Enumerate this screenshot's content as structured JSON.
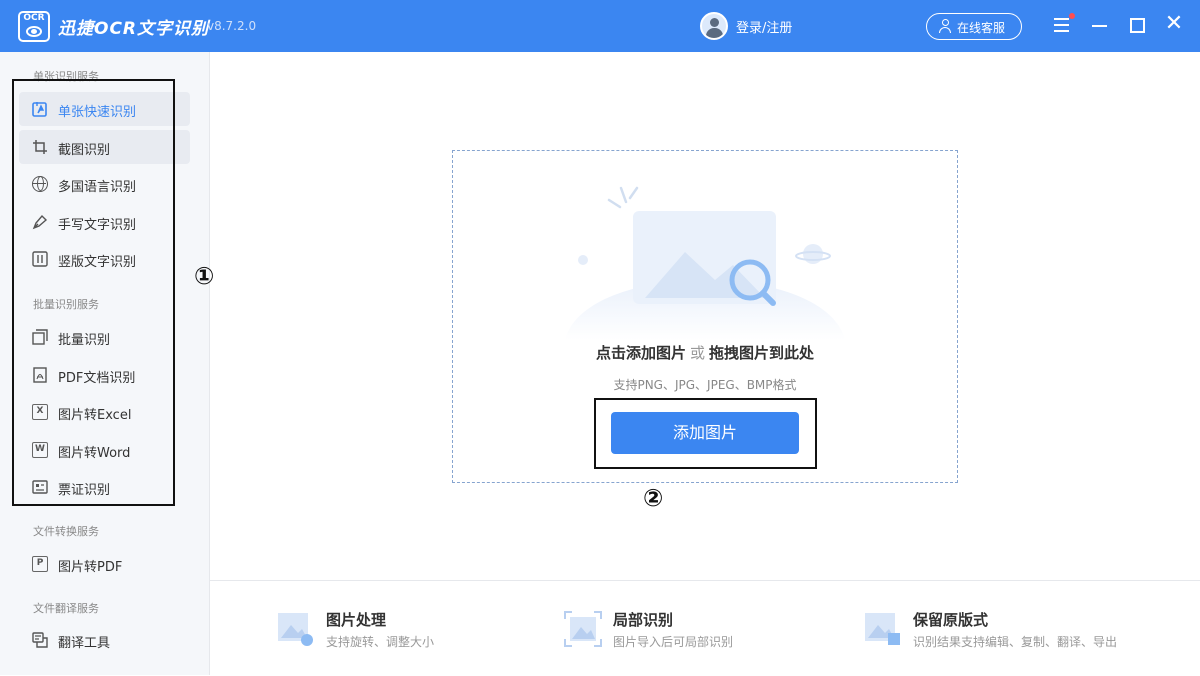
{
  "window": {
    "logo_text": "OCR",
    "title": "迅捷OCR文字识别",
    "version": "v8.7.2.0",
    "login_label": "登录/注册",
    "service_label": "在线客服",
    "close_glyph": "✕"
  },
  "sidebar": {
    "sections": [
      {
        "title": "单张识别服务",
        "items": [
          {
            "label": "单张快速识别",
            "icon": "quick-recognize-icon",
            "active": true
          },
          {
            "label": "截图识别",
            "icon": "crop-icon"
          },
          {
            "label": "多国语言识别",
            "icon": "globe-icon"
          },
          {
            "label": "手写文字识别",
            "icon": "pen-icon"
          },
          {
            "label": "竖版文字识别",
            "icon": "vertical-text-icon"
          }
        ]
      },
      {
        "title": "批量识别服务",
        "items": [
          {
            "label": "批量识别",
            "icon": "batch-icon"
          },
          {
            "label": "PDF文档识别",
            "icon": "pdf-icon"
          },
          {
            "label": "图片转Excel",
            "icon": "excel-icon",
            "icon_letter": "X"
          },
          {
            "label": "图片转Word",
            "icon": "word-icon",
            "icon_letter": "W"
          },
          {
            "label": "票证识别",
            "icon": "ticket-icon"
          }
        ]
      },
      {
        "title": "文件转换服务",
        "items": [
          {
            "label": "图片转PDF",
            "icon": "image-to-pdf-icon",
            "icon_letter": "P"
          }
        ]
      },
      {
        "title": "文件翻译服务",
        "items": [
          {
            "label": "翻译工具",
            "icon": "translate-icon"
          }
        ]
      }
    ]
  },
  "annotations": {
    "marker_1": "①",
    "marker_2": "②"
  },
  "upload": {
    "hint_primary": "点击添加图片",
    "hint_or": "或",
    "hint_secondary": "拖拽图片到此处",
    "formats": "支持PNG、JPG、JPEG、BMP格式",
    "button_label": "添加图片"
  },
  "features": [
    {
      "title": "图片处理",
      "desc": "支持旋转、调整大小"
    },
    {
      "title": "局部识别",
      "desc": "图片导入后可局部识别"
    },
    {
      "title": "保留原版式",
      "desc": "识别结果支持编辑、复制、翻译、导出"
    }
  ],
  "colors": {
    "brand": "#3b86f1",
    "sidebar_bg": "#f5f7fa"
  }
}
